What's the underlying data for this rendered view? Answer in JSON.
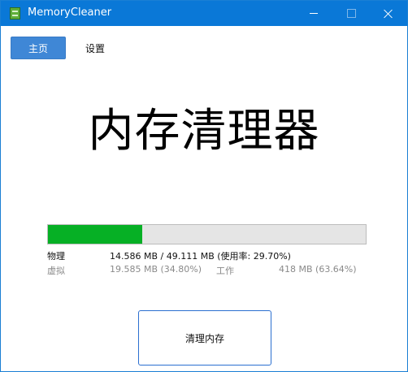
{
  "window": {
    "title": "MemoryCleaner",
    "accent_color": "#0a78d7",
    "icons": [
      "app-icon",
      "minimize-icon",
      "maximize-icon",
      "close-icon"
    ]
  },
  "tabs": {
    "home_label": "主页",
    "settings_label": "设置",
    "active": "主页"
  },
  "headline": "内存清理器",
  "memory_bar": {
    "usage_fraction": 0.297,
    "fill_color": "#06b025"
  },
  "physical": {
    "label": "物理",
    "usage": "14.586 MB / 49.111 MB (使用率: 29.70%)"
  },
  "virtual": {
    "label": "虚拟",
    "value": "19.585 MB (34.80%)",
    "work_label": "工作",
    "work_value": "418 MB (63.64%)"
  },
  "clean_button": {
    "label": "清理内存"
  }
}
